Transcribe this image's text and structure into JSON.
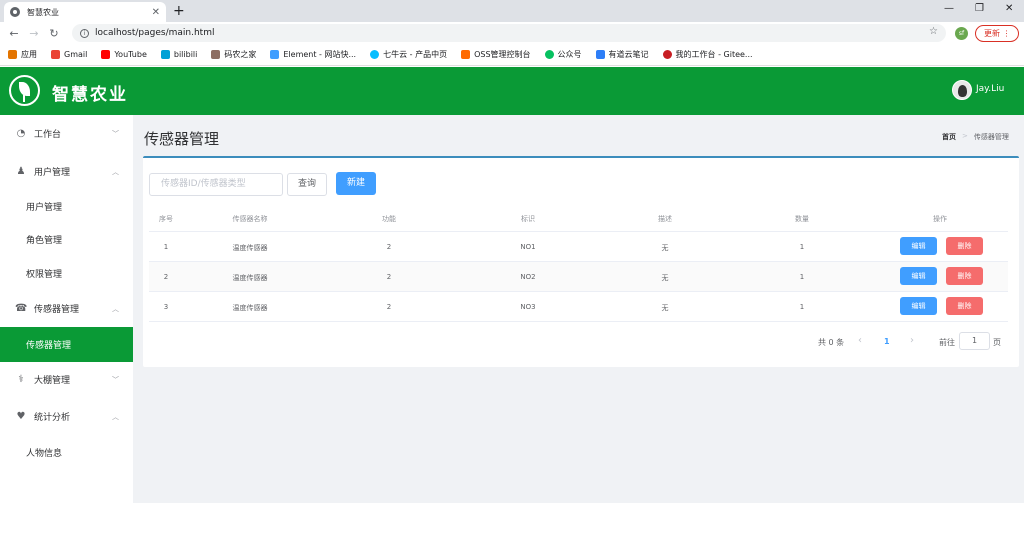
{
  "browser": {
    "tab_title": "智慧农业",
    "url": "localhost/pages/main.html",
    "profile": "sf",
    "update_label": "更新",
    "bookmarks": [
      "应用",
      "Gmail",
      "YouTube",
      "bilibili",
      "码农之家",
      "Element - 网站快...",
      "七牛云 - 产品中页",
      "OSS管理控制台",
      "公众号",
      "有道云笔记",
      "我的工作台 - Gitee..."
    ]
  },
  "app": {
    "logo_text": "智慧农业",
    "user_name": "Jay.Liu"
  },
  "sidebar": {
    "items": [
      {
        "label": "工作台",
        "icon": "dashboard-icon",
        "arrow": "﹀"
      },
      {
        "label": "用户管理",
        "icon": "user-icon",
        "arrow": "︿"
      },
      {
        "label": "用户管理"
      },
      {
        "label": "角色管理"
      },
      {
        "label": "权限管理"
      },
      {
        "label": "传感器管理",
        "icon": "sensor-icon",
        "arrow": "︿"
      },
      {
        "label": "传感器管理"
      },
      {
        "label": "大棚管理",
        "icon": "stethoscope-icon",
        "arrow": "﹀"
      },
      {
        "label": "统计分析",
        "icon": "heartbeat-icon",
        "arrow": "︿"
      },
      {
        "label": "人物信息"
      }
    ]
  },
  "main": {
    "title": "传感器管理",
    "breadcrumb": [
      "首页",
      "传感器管理"
    ],
    "search_placeholder": "传感器ID/传感器类型",
    "query_label": "查询",
    "new_label": "新建",
    "table": {
      "headers": [
        "序号",
        "传感器名称",
        "功能",
        "标识",
        "描述",
        "数量",
        "操作"
      ],
      "rows": [
        [
          "1",
          "温度传感器",
          "2",
          "NO1",
          "无",
          "1"
        ],
        [
          "2",
          "温度传感器",
          "2",
          "NO2",
          "无",
          "1"
        ],
        [
          "3",
          "温度传感器",
          "2",
          "NO3",
          "无",
          "1"
        ]
      ],
      "edit_label": "编辑",
      "delete_label": "删除"
    },
    "pagination": {
      "total_text": "共 0 条",
      "current_page": "1",
      "goto_label": "前往",
      "goto_value": "1",
      "unit": "页"
    }
  }
}
